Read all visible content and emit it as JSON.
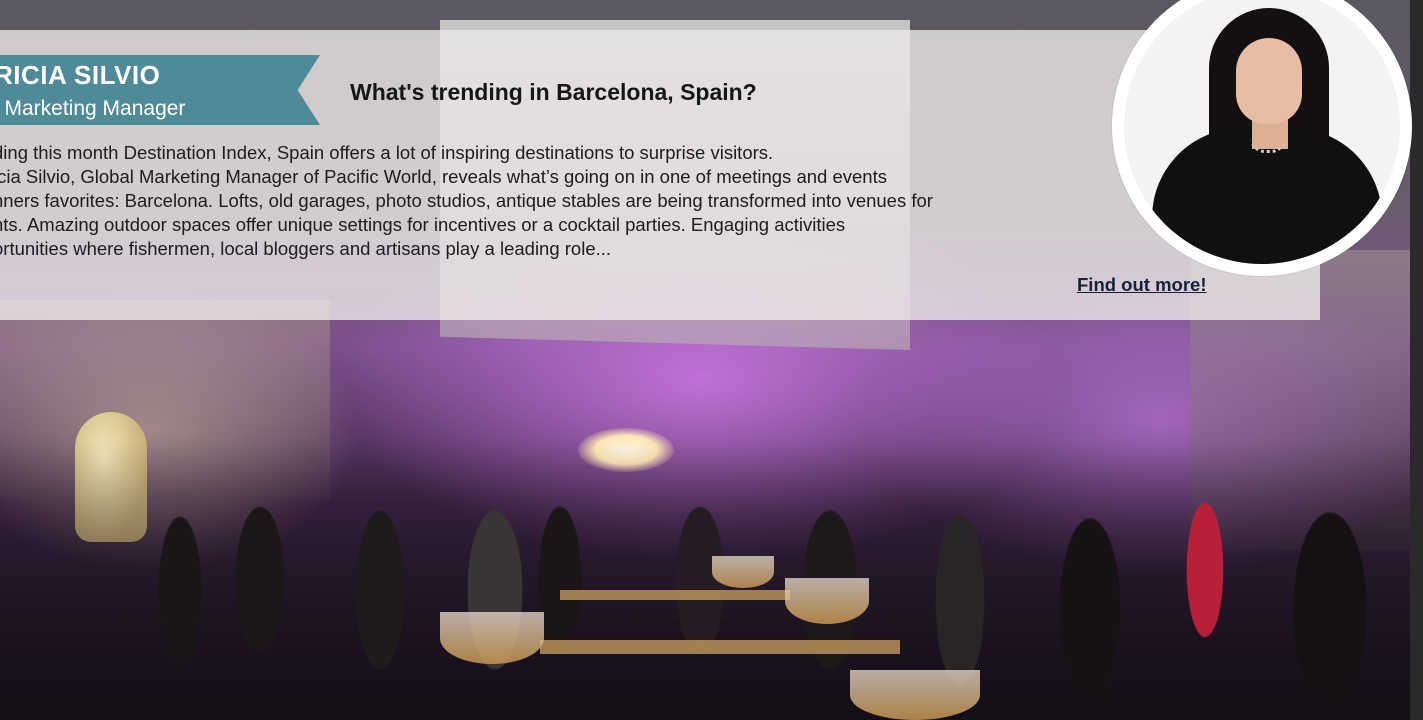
{
  "profile": {
    "name": "RICIA SILVIO",
    "role": "l Marketing Manager",
    "ribbon_color": "#4f8a98",
    "avatar_alt": "portrait"
  },
  "article": {
    "headline": "What's trending in Barcelona, Spain?",
    "body_lines": [
      "ding this month Destination Index, Spain offers a lot of inspiring destinations to surprise visitors.",
      "icia Silvio, Global Marketing Manager of Pacific World, reveals what’s going on in one of meetings and events",
      "nners favorites: Barcelona. Lofts, old garages, photo studios, antique stables are being transformed into venues for",
      "nts. Amazing outdoor spaces offer unique settings for incentives or a cocktail parties. Engaging activities",
      "ortunities where fishermen, local bloggers and artisans play a leading role..."
    ],
    "cta_label": "Find out more!"
  },
  "background": {
    "description_icon": "event-photo",
    "accent_purple": "#b45fd0"
  }
}
